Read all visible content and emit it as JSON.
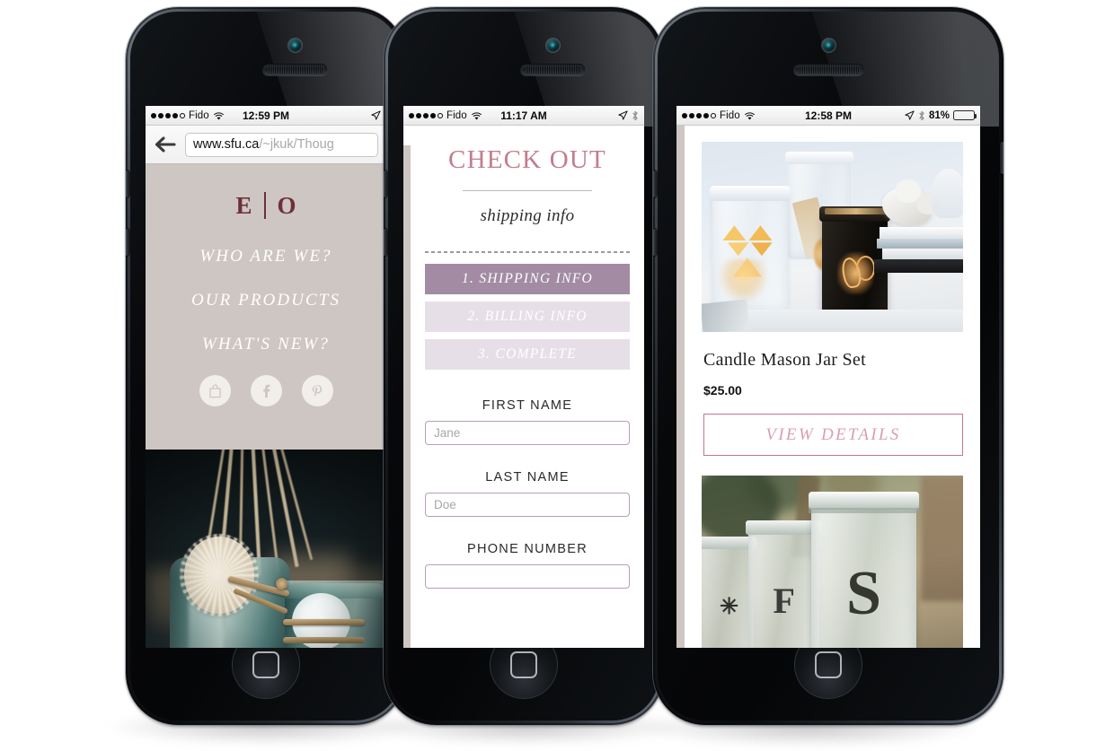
{
  "scene": {
    "description": "Three iPhone mockups showing a responsive e-commerce website",
    "device_count": 3
  },
  "phone1": {
    "status_bar": {
      "signal_dots_filled": 4,
      "signal_dots_total": 5,
      "carrier": "Fido",
      "wifi_icon": "wifi-icon",
      "time": "12:59 PM",
      "location_icon": "location-arrow-icon"
    },
    "browser": {
      "back_icon": "back-arrow-icon",
      "url_host": "www.sfu.ca",
      "url_path": "/~jkuk/Thoug",
      "url_full": "www.sfu.ca/~jkuk/Thoug"
    },
    "nav": {
      "logo_left": "E",
      "logo_divider": "|",
      "logo_right": "O",
      "links": [
        {
          "label": "WHO ARE WE?"
        },
        {
          "label": "OUR PRODUCTS"
        },
        {
          "label": "WHAT'S NEW?"
        }
      ],
      "social": [
        {
          "name": "shopping-bag-icon"
        },
        {
          "name": "facebook-icon"
        },
        {
          "name": "pinterest-icon"
        }
      ]
    },
    "hero_photo_alt": "Teal vintage mason jars with reed diffuser sticks, dried flower and twine"
  },
  "phone2": {
    "status_bar": {
      "signal_dots_filled": 4,
      "signal_dots_total": 5,
      "carrier": "Fido",
      "wifi_icon": "wifi-icon",
      "time": "11:17 AM",
      "location_icon": "location-arrow-icon",
      "bluetooth_icon": "bluetooth-icon"
    },
    "checkout": {
      "title": "CHECK OUT",
      "subtitle": "shipping info",
      "steps": [
        {
          "label": "1. SHIPPING INFO",
          "state": "active"
        },
        {
          "label": "2. BILLING INFO",
          "state": "idle"
        },
        {
          "label": "3. COMPLETE",
          "state": "idle"
        }
      ],
      "fields": [
        {
          "label": "FIRST NAME",
          "placeholder": "Jane"
        },
        {
          "label": "LAST NAME",
          "placeholder": "Doe"
        },
        {
          "label": "PHONE NUMBER",
          "placeholder": ""
        }
      ]
    }
  },
  "phone3": {
    "status_bar": {
      "signal_dots_filled": 4,
      "signal_dots_total": 5,
      "carrier": "Fido",
      "wifi_icon": "wifi-icon",
      "time": "12:58 PM",
      "location_icon": "location-arrow-icon",
      "bluetooth_icon": "bluetooth-icon",
      "battery_percent": "81%",
      "battery_level": 81
    },
    "product": {
      "image_alt": "Painted mason jar candle holders with glowing geometric and monogram cutouts",
      "name": "Candle Mason Jar Set",
      "price": "$25.00",
      "cta_label": "VIEW DETAILS"
    },
    "product_next": {
      "image_alt": "Three glass mason jars with stencilled monogram letters outdoors"
    }
  },
  "colors": {
    "nav_background": "#cec6c2",
    "logo_maroon": "#6e3038",
    "checkout_pink": "#c27d8d",
    "step_active": "#a28ba3",
    "step_idle": "#e7dfe8",
    "input_border": "#b79fb9",
    "cta_border": "#c1788a",
    "cta_text": "#d99fae",
    "device_black": "#07080a"
  }
}
